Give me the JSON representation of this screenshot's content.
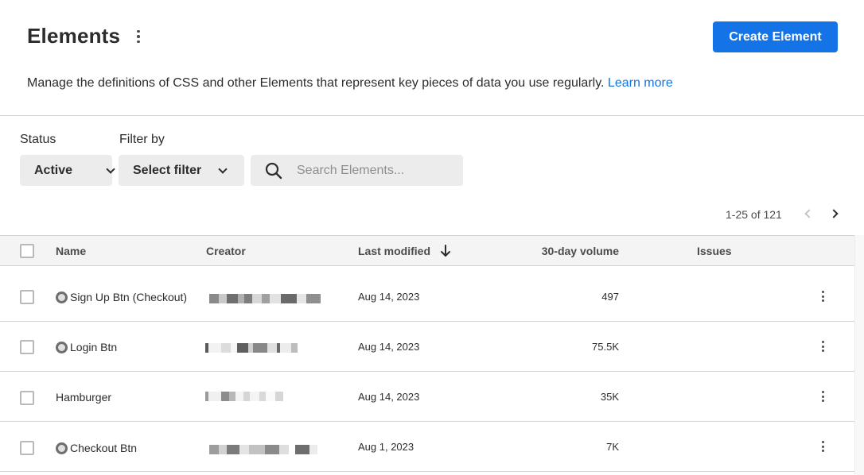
{
  "header": {
    "title": "Elements",
    "create_button": "Create Element",
    "description": "Manage the definitions of CSS and other Elements that represent key pieces of data you use regularly.",
    "learn_more": "Learn more"
  },
  "filters": {
    "status_label": "Status",
    "status_value": "Active",
    "filter_label": "Filter by",
    "filter_value": "Select filter",
    "search_placeholder": "Search Elements..."
  },
  "pagination": {
    "range_text": "1-25 of 121"
  },
  "table": {
    "columns": [
      "Name",
      "Creator",
      "Last modified",
      "30-day volume",
      "Issues"
    ],
    "sort_column": "Last modified",
    "sort_direction": "descending",
    "rows": [
      {
        "name": "Sign Up Btn (Checkout)",
        "has_status_icon": true,
        "creator": "[redacted]",
        "last_modified": "Aug 14, 2023",
        "volume": "497",
        "issues": ""
      },
      {
        "name": "Login Btn",
        "has_status_icon": true,
        "creator": "[redacted]",
        "last_modified": "Aug 14, 2023",
        "volume": "75.5K",
        "issues": ""
      },
      {
        "name": "Hamburger",
        "has_status_icon": false,
        "creator": "[redacted]",
        "last_modified": "Aug 14, 2023",
        "volume": "35K",
        "issues": ""
      },
      {
        "name": "Checkout Btn",
        "has_status_icon": true,
        "creator": "[redacted]",
        "last_modified": "Aug 1, 2023",
        "volume": "7K",
        "issues": ""
      }
    ]
  },
  "colors": {
    "accent": "#1473e6",
    "text": "#2c2c2c",
    "control_bg": "#ececec"
  }
}
